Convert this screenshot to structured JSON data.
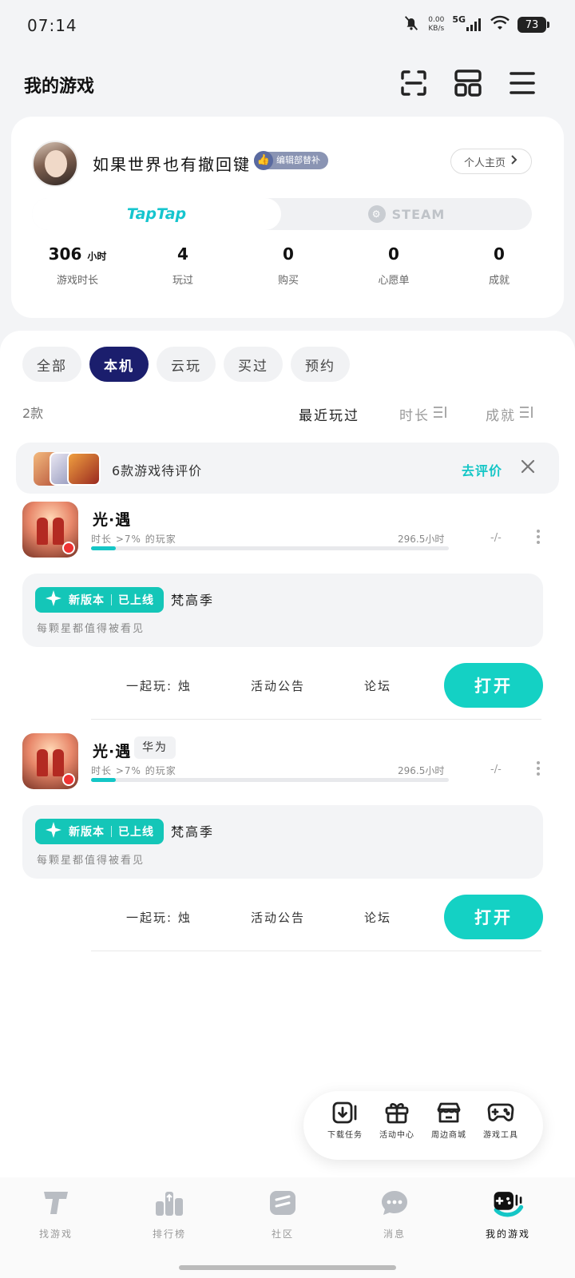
{
  "status_bar": {
    "time": "07:14",
    "net_speed_value": "0.00",
    "net_speed_unit": "KB/s",
    "network": "5G",
    "battery": "73"
  },
  "header": {
    "title": "我的游戏",
    "icons": [
      "scan-icon",
      "layout-grid-icon",
      "menu-icon"
    ]
  },
  "profile": {
    "username": "如果世界也有撤回键",
    "badge": "编辑部替补",
    "home_button": "个人主页",
    "platforms": {
      "taptap": "TapTap",
      "steam": "STEAM",
      "active": "taptap"
    },
    "stats": [
      {
        "value": "306",
        "unit": "小时",
        "label": "游戏时长"
      },
      {
        "value": "4",
        "unit": "",
        "label": "玩过"
      },
      {
        "value": "0",
        "unit": "",
        "label": "购买"
      },
      {
        "value": "0",
        "unit": "",
        "label": "心愿单"
      },
      {
        "value": "0",
        "unit": "",
        "label": "成就"
      }
    ]
  },
  "filters": [
    "全部",
    "本机",
    "云玩",
    "买过",
    "预约"
  ],
  "active_filter": "本机",
  "list_header": {
    "count": "2款",
    "sorts": [
      "最近玩过",
      "时长",
      "成就"
    ],
    "active_sort": "最近玩过"
  },
  "review_prompt": {
    "text": "6款游戏待评价",
    "link": "去评价"
  },
  "games": [
    {
      "name": "光·遇",
      "tag": "",
      "subtitle": "时长 >7% 的玩家",
      "hours": "296.5小时",
      "progress": 0.07,
      "achievement": "-/-",
      "news": {
        "pill_a": "新版本",
        "pill_b": "已上线",
        "title": "梵高季",
        "desc": "每颗星都值得被看见"
      },
      "actions": [
        "一起玩: 烛",
        "活动公告",
        "论坛"
      ],
      "open_label": "打开"
    },
    {
      "name": "光·遇",
      "tag": "华为",
      "subtitle": "时长 >7% 的玩家",
      "hours": "296.5小时",
      "progress": 0.07,
      "achievement": "-/-",
      "news": {
        "pill_a": "新版本",
        "pill_b": "已上线",
        "title": "梵高季",
        "desc": "每颗星都值得被看见"
      },
      "actions": [
        "一起玩: 烛",
        "活动公告",
        "论坛"
      ],
      "open_label": "打开"
    }
  ],
  "tools": [
    {
      "label": "下载任务",
      "icon": "download-icon"
    },
    {
      "label": "活动中心",
      "icon": "gift-icon"
    },
    {
      "label": "周边商城",
      "icon": "shop-icon"
    },
    {
      "label": "游戏工具",
      "icon": "gamepad-icon"
    }
  ],
  "bottom_nav": [
    {
      "label": "找游戏",
      "icon": "taptap-icon"
    },
    {
      "label": "排行榜",
      "icon": "ranking-icon"
    },
    {
      "label": "社区",
      "icon": "community-icon"
    },
    {
      "label": "消息",
      "icon": "message-icon"
    },
    {
      "label": "我的游戏",
      "icon": "my-games-icon"
    }
  ],
  "active_nav": "我的游戏",
  "colors": {
    "accent": "#14c6c6",
    "open_button": "#14d1c4",
    "active_filter": "#1b1e6d",
    "badge": "#8a94b3"
  }
}
